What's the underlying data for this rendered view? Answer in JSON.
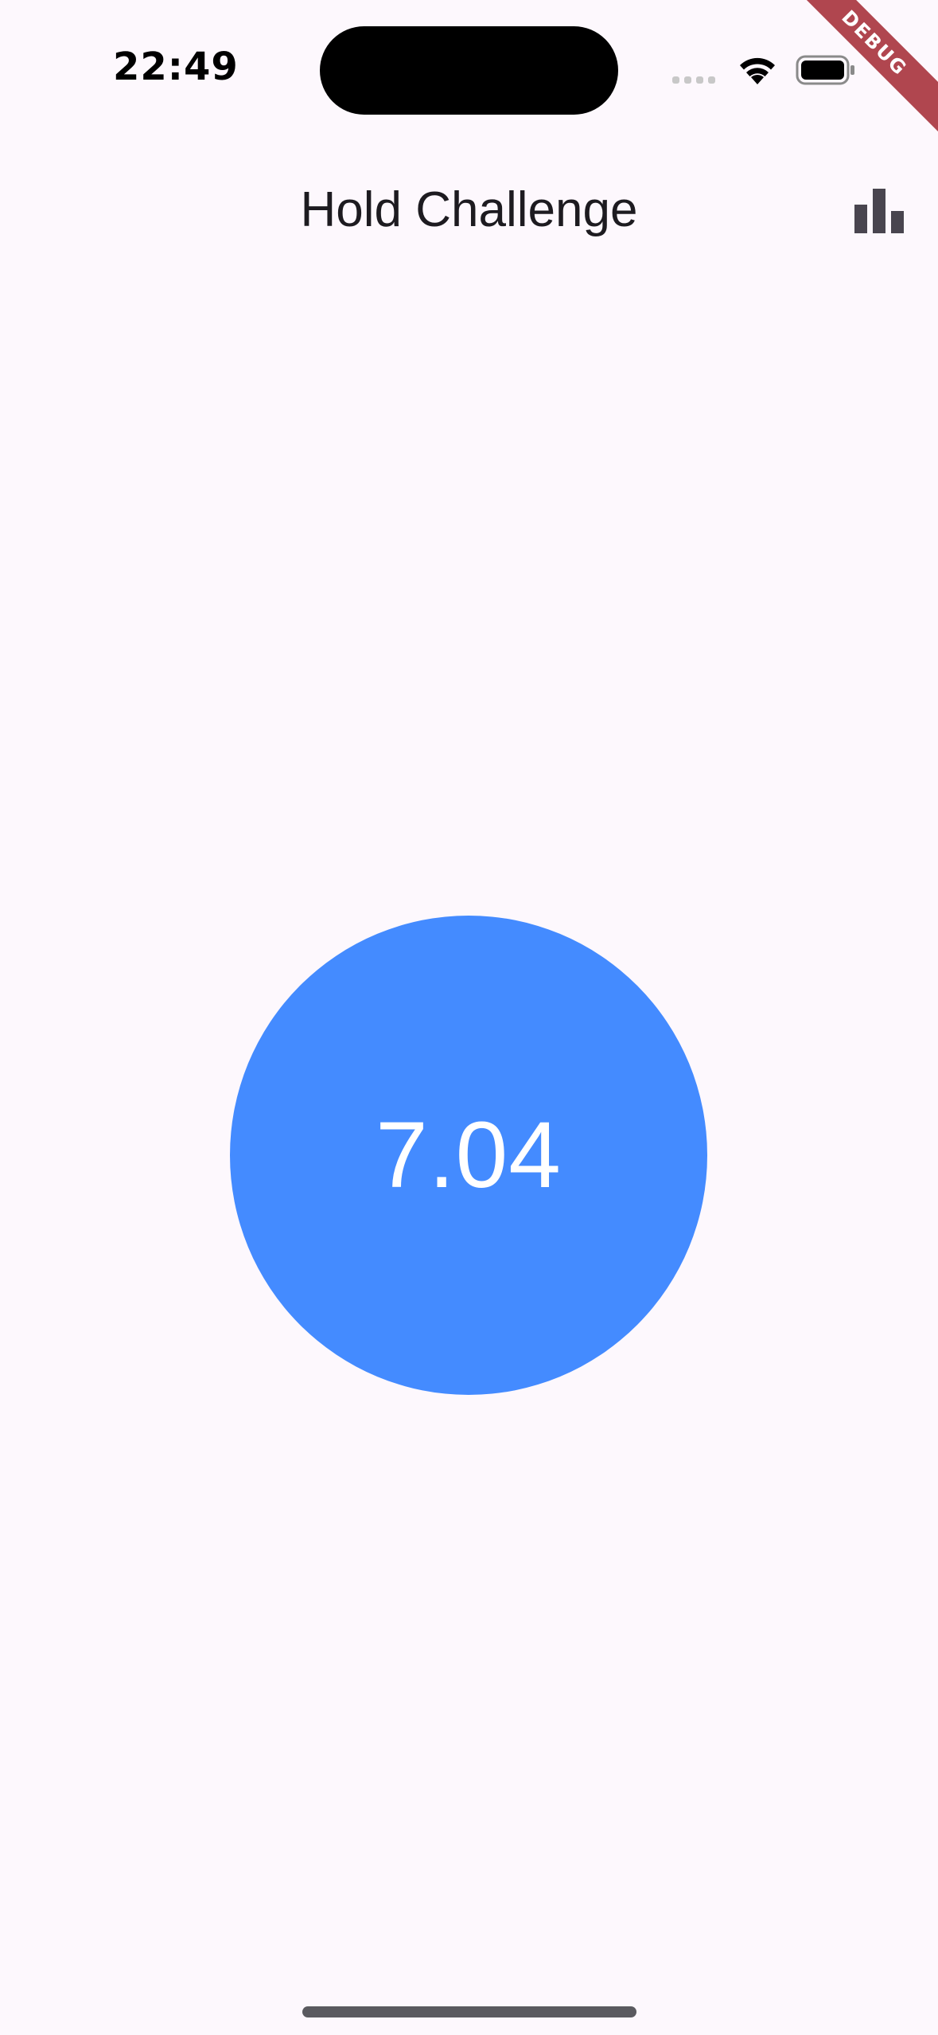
{
  "status_bar": {
    "time": "22:49"
  },
  "debug_banner": "DEBUG",
  "app_bar": {
    "title": "Hold Challenge",
    "stats_icon": "bar-chart-icon"
  },
  "timer": {
    "value": "7.04"
  },
  "colors": {
    "background": "#fdf8fd",
    "circle": "#448bff",
    "title": "#1d1b20",
    "icon": "#49454f",
    "debug_ribbon": "#b0464f"
  }
}
